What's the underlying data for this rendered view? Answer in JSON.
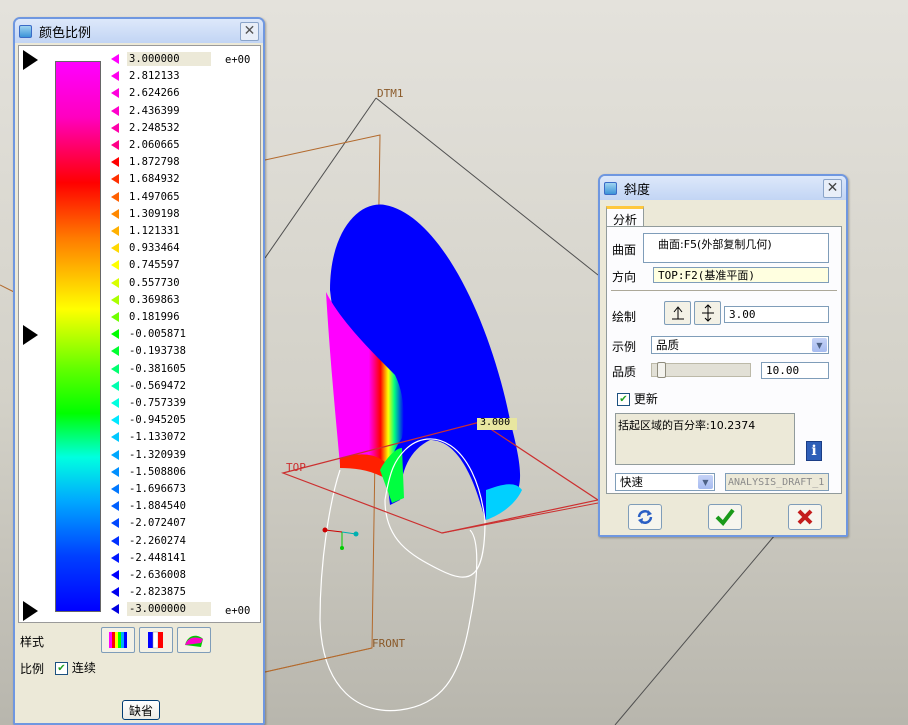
{
  "viewport": {
    "labels": {
      "dtm1": "DTM1",
      "top": "TOP",
      "front": "FRONT",
      "value_tag": "3.000"
    }
  },
  "color_scale_dialog": {
    "title": "颜色比例",
    "exponent_top": "e+00",
    "exponent_bottom": "e+00",
    "values": [
      "3.000000",
      "2.812133",
      "2.624266",
      "2.436399",
      "2.248532",
      "2.060665",
      "1.872798",
      "1.684932",
      "1.497065",
      "1.309198",
      "1.121331",
      "0.933464",
      "0.745597",
      "0.557730",
      "0.369863",
      "0.181996",
      "-0.005871",
      "-0.193738",
      "-0.381605",
      "-0.569472",
      "-0.757339",
      "-0.945205",
      "-1.133072",
      "-1.320939",
      "-1.508806",
      "-1.696673",
      "-1.884540",
      "-2.072407",
      "-2.260274",
      "-2.448141",
      "-2.636008",
      "-2.823875",
      "-3.000000"
    ],
    "swatch_colors": [
      "#ff00ff",
      "#ff00ee",
      "#ff00dd",
      "#ff00cc",
      "#ff00aa",
      "#ff0088",
      "#ff0000",
      "#ff3000",
      "#ff6000",
      "#ff8800",
      "#ffb000",
      "#ffd800",
      "#ffff00",
      "#d8ff00",
      "#aaff00",
      "#70ff00",
      "#00ff00",
      "#00ff30",
      "#00ff70",
      "#00ffb0",
      "#00ffe0",
      "#00e8ff",
      "#00c8ff",
      "#00a8ff",
      "#0090ff",
      "#0078ff",
      "#0060ff",
      "#0048ff",
      "#0030ff",
      "#0018ff",
      "#0000ff",
      "#0000f0",
      "#0000e0"
    ],
    "style_label": "样式",
    "scale_label": "比例",
    "continuous_label": "连续",
    "continuous_checked": true,
    "default_button": "缺省"
  },
  "draft_dialog": {
    "title": "斜度",
    "tab_analysis": "分析",
    "surface_label": "曲面",
    "surface_value": "曲面:F5(外部复制几何)",
    "direction_label": "方向",
    "direction_value": "TOP:F2(基准平面)",
    "plot_label": "绘制",
    "plot_value": "3.00",
    "example_label": "示例",
    "example_value": "品质",
    "quality_label": "品质",
    "quality_value": "10.00",
    "update_label": "更新",
    "update_checked": true,
    "result_text": "括起区域的百分率:10.2374",
    "mode_value": "快速",
    "name_value": "ANALYSIS_DRAFT_1"
  }
}
